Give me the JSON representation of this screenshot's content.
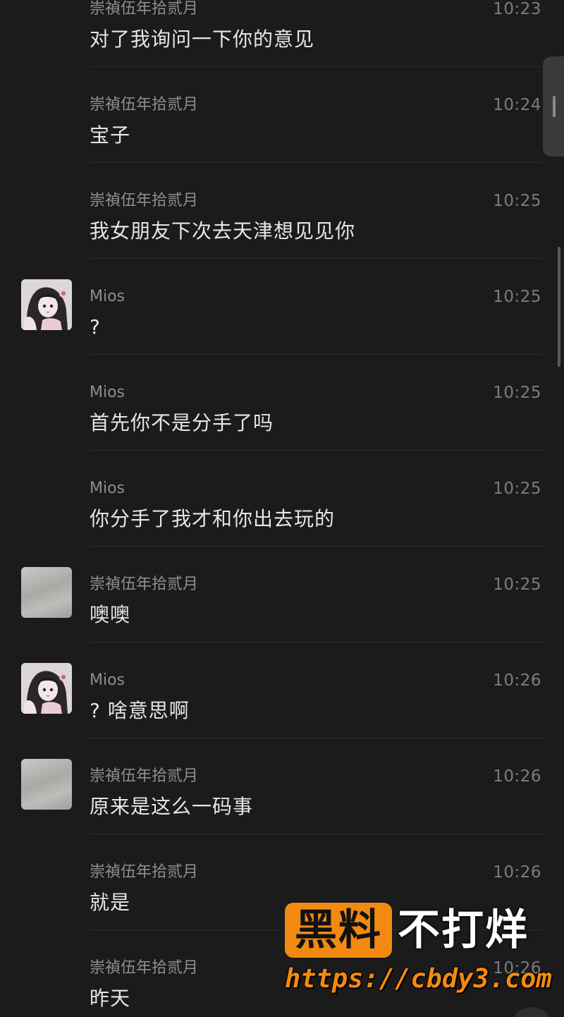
{
  "messages": [
    {
      "sender": "崇禎伍年拾贰月",
      "time": "10:23",
      "text": "对了我询问一下你的意见",
      "avatar": "none"
    },
    {
      "sender": "崇禎伍年拾贰月",
      "time": "10:24",
      "text": "宝子",
      "avatar": "none"
    },
    {
      "sender": "崇禎伍年拾贰月",
      "time": "10:25",
      "text": "我女朋友下次去天津想见见你",
      "avatar": "none"
    },
    {
      "sender": "Mios",
      "time": "10:25",
      "text": "?",
      "avatar": "anime-girl-avatar"
    },
    {
      "sender": "Mios",
      "time": "10:25",
      "text": "首先你不是分手了吗",
      "avatar": "none"
    },
    {
      "sender": "Mios",
      "time": "10:25",
      "text": "你分手了我才和你出去玩的",
      "avatar": "none"
    },
    {
      "sender": "崇禎伍年拾贰月",
      "time": "10:25",
      "text": "噢噢",
      "avatar": "gray-marble-avatar"
    },
    {
      "sender": "Mios",
      "time": "10:26",
      "text": "? 啥意思啊",
      "avatar": "anime-girl-avatar"
    },
    {
      "sender": "崇禎伍年拾贰月",
      "time": "10:26",
      "text": "原来是这么一码事",
      "avatar": "gray-marble-avatar"
    },
    {
      "sender": "崇禎伍年拾贰月",
      "time": "10:26",
      "text": "就是",
      "avatar": "none"
    },
    {
      "sender": "崇禎伍年拾贰月",
      "time": "10:26",
      "text": "昨天",
      "avatar": "none"
    }
  ],
  "watermark": {
    "box_text": "黑料",
    "right_text": "不打烊",
    "url": "https://cbdy3.com",
    "accent_color": "#f28a12"
  }
}
